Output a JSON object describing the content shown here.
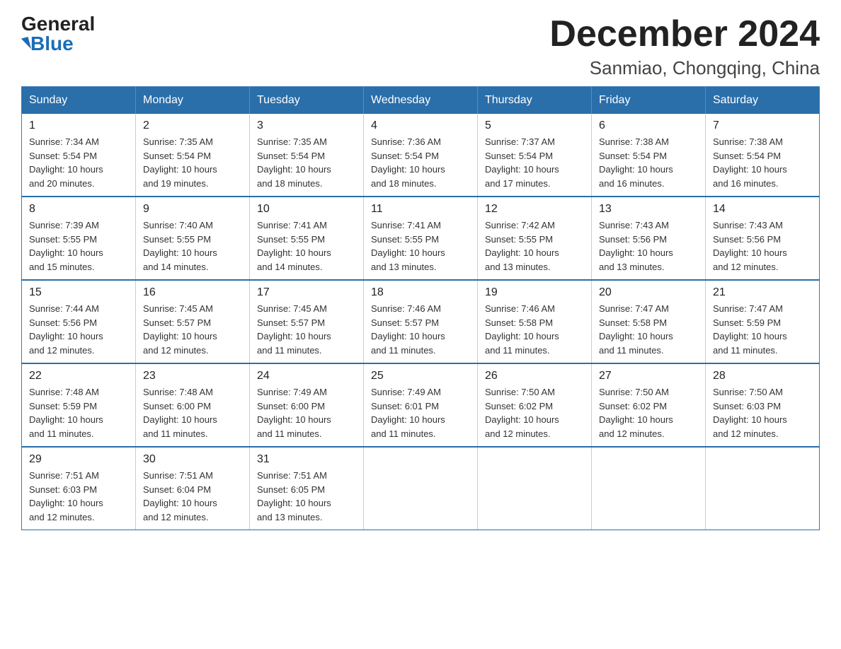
{
  "logo": {
    "general": "General",
    "blue": "Blue"
  },
  "title": {
    "month": "December 2024",
    "location": "Sanmiao, Chongqing, China"
  },
  "weekdays": [
    "Sunday",
    "Monday",
    "Tuesday",
    "Wednesday",
    "Thursday",
    "Friday",
    "Saturday"
  ],
  "weeks": [
    [
      {
        "day": "1",
        "sunrise": "7:34 AM",
        "sunset": "5:54 PM",
        "daylight": "10 hours and 20 minutes."
      },
      {
        "day": "2",
        "sunrise": "7:35 AM",
        "sunset": "5:54 PM",
        "daylight": "10 hours and 19 minutes."
      },
      {
        "day": "3",
        "sunrise": "7:35 AM",
        "sunset": "5:54 PM",
        "daylight": "10 hours and 18 minutes."
      },
      {
        "day": "4",
        "sunrise": "7:36 AM",
        "sunset": "5:54 PM",
        "daylight": "10 hours and 18 minutes."
      },
      {
        "day": "5",
        "sunrise": "7:37 AM",
        "sunset": "5:54 PM",
        "daylight": "10 hours and 17 minutes."
      },
      {
        "day": "6",
        "sunrise": "7:38 AM",
        "sunset": "5:54 PM",
        "daylight": "10 hours and 16 minutes."
      },
      {
        "day": "7",
        "sunrise": "7:38 AM",
        "sunset": "5:54 PM",
        "daylight": "10 hours and 16 minutes."
      }
    ],
    [
      {
        "day": "8",
        "sunrise": "7:39 AM",
        "sunset": "5:55 PM",
        "daylight": "10 hours and 15 minutes."
      },
      {
        "day": "9",
        "sunrise": "7:40 AM",
        "sunset": "5:55 PM",
        "daylight": "10 hours and 14 minutes."
      },
      {
        "day": "10",
        "sunrise": "7:41 AM",
        "sunset": "5:55 PM",
        "daylight": "10 hours and 14 minutes."
      },
      {
        "day": "11",
        "sunrise": "7:41 AM",
        "sunset": "5:55 PM",
        "daylight": "10 hours and 13 minutes."
      },
      {
        "day": "12",
        "sunrise": "7:42 AM",
        "sunset": "5:55 PM",
        "daylight": "10 hours and 13 minutes."
      },
      {
        "day": "13",
        "sunrise": "7:43 AM",
        "sunset": "5:56 PM",
        "daylight": "10 hours and 13 minutes."
      },
      {
        "day": "14",
        "sunrise": "7:43 AM",
        "sunset": "5:56 PM",
        "daylight": "10 hours and 12 minutes."
      }
    ],
    [
      {
        "day": "15",
        "sunrise": "7:44 AM",
        "sunset": "5:56 PM",
        "daylight": "10 hours and 12 minutes."
      },
      {
        "day": "16",
        "sunrise": "7:45 AM",
        "sunset": "5:57 PM",
        "daylight": "10 hours and 12 minutes."
      },
      {
        "day": "17",
        "sunrise": "7:45 AM",
        "sunset": "5:57 PM",
        "daylight": "10 hours and 11 minutes."
      },
      {
        "day": "18",
        "sunrise": "7:46 AM",
        "sunset": "5:57 PM",
        "daylight": "10 hours and 11 minutes."
      },
      {
        "day": "19",
        "sunrise": "7:46 AM",
        "sunset": "5:58 PM",
        "daylight": "10 hours and 11 minutes."
      },
      {
        "day": "20",
        "sunrise": "7:47 AM",
        "sunset": "5:58 PM",
        "daylight": "10 hours and 11 minutes."
      },
      {
        "day": "21",
        "sunrise": "7:47 AM",
        "sunset": "5:59 PM",
        "daylight": "10 hours and 11 minutes."
      }
    ],
    [
      {
        "day": "22",
        "sunrise": "7:48 AM",
        "sunset": "5:59 PM",
        "daylight": "10 hours and 11 minutes."
      },
      {
        "day": "23",
        "sunrise": "7:48 AM",
        "sunset": "6:00 PM",
        "daylight": "10 hours and 11 minutes."
      },
      {
        "day": "24",
        "sunrise": "7:49 AM",
        "sunset": "6:00 PM",
        "daylight": "10 hours and 11 minutes."
      },
      {
        "day": "25",
        "sunrise": "7:49 AM",
        "sunset": "6:01 PM",
        "daylight": "10 hours and 11 minutes."
      },
      {
        "day": "26",
        "sunrise": "7:50 AM",
        "sunset": "6:02 PM",
        "daylight": "10 hours and 12 minutes."
      },
      {
        "day": "27",
        "sunrise": "7:50 AM",
        "sunset": "6:02 PM",
        "daylight": "10 hours and 12 minutes."
      },
      {
        "day": "28",
        "sunrise": "7:50 AM",
        "sunset": "6:03 PM",
        "daylight": "10 hours and 12 minutes."
      }
    ],
    [
      {
        "day": "29",
        "sunrise": "7:51 AM",
        "sunset": "6:03 PM",
        "daylight": "10 hours and 12 minutes."
      },
      {
        "day": "30",
        "sunrise": "7:51 AM",
        "sunset": "6:04 PM",
        "daylight": "10 hours and 12 minutes."
      },
      {
        "day": "31",
        "sunrise": "7:51 AM",
        "sunset": "6:05 PM",
        "daylight": "10 hours and 13 minutes."
      },
      null,
      null,
      null,
      null
    ]
  ],
  "labels": {
    "sunrise": "Sunrise:",
    "sunset": "Sunset:",
    "daylight": "Daylight:"
  }
}
